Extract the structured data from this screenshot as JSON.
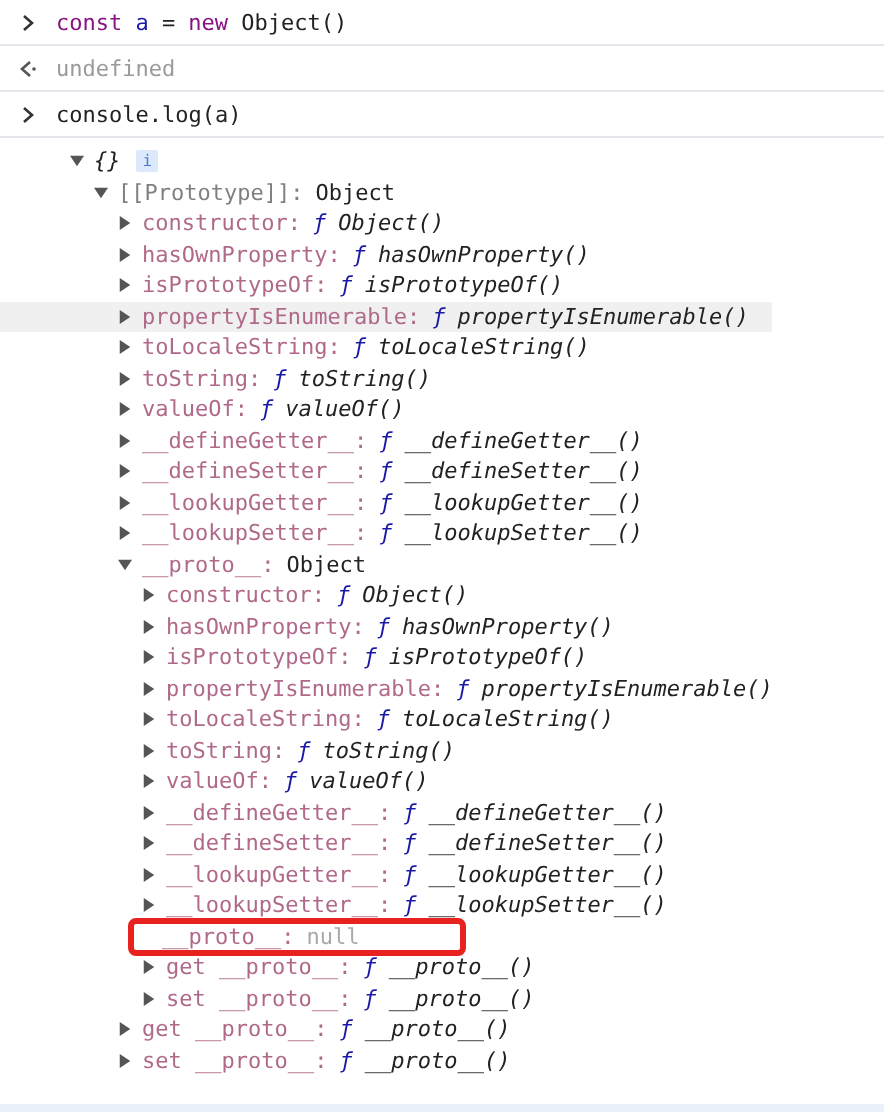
{
  "console": [
    {
      "kind": "input",
      "tokens": [
        {
          "text": "const",
          "kind": "keyword"
        },
        {
          "text": "a",
          "kind": "variable"
        },
        {
          "text": "=",
          "kind": "plain"
        },
        {
          "text": "new",
          "kind": "keyword"
        },
        {
          "text": "Object()",
          "kind": "plain"
        }
      ]
    },
    {
      "kind": "result",
      "text": "undefined"
    },
    {
      "kind": "input",
      "tokens": [
        {
          "text": "console.log(a)",
          "kind": "plain"
        }
      ]
    },
    {
      "kind": "log",
      "tree": {
        "label": "{}",
        "badge": "i",
        "expanded": true,
        "children": [
          {
            "key": "[[Prototype]]:",
            "kind": "object",
            "internal": true,
            "value": "Object",
            "expanded": true,
            "highlighted": false,
            "children": [
              {
                "key": "constructor:",
                "kind": "function",
                "marker": "ƒ",
                "value": "Object()",
                "expanded": false,
                "highlighted": false
              },
              {
                "key": "hasOwnProperty:",
                "kind": "function",
                "marker": "ƒ",
                "value": "hasOwnProperty()",
                "expanded": false,
                "highlighted": false
              },
              {
                "key": "isPrototypeOf:",
                "kind": "function",
                "marker": "ƒ",
                "value": "isPrototypeOf()",
                "expanded": false,
                "highlighted": false
              },
              {
                "key": "propertyIsEnumerable:",
                "kind": "function",
                "marker": "ƒ",
                "value": "propertyIsEnumerable()",
                "expanded": false,
                "highlighted": true
              },
              {
                "key": "toLocaleString:",
                "kind": "function",
                "marker": "ƒ",
                "value": "toLocaleString()",
                "expanded": false,
                "highlighted": false
              },
              {
                "key": "toString:",
                "kind": "function",
                "marker": "ƒ",
                "value": "toString()",
                "expanded": false,
                "highlighted": false
              },
              {
                "key": "valueOf:",
                "kind": "function",
                "marker": "ƒ",
                "value": "valueOf()",
                "expanded": false,
                "highlighted": false
              },
              {
                "key": "__defineGetter__:",
                "kind": "function",
                "marker": "ƒ",
                "value": "__defineGetter__()",
                "expanded": false,
                "highlighted": false
              },
              {
                "key": "__defineSetter__:",
                "kind": "function",
                "marker": "ƒ",
                "value": "__defineSetter__()",
                "expanded": false,
                "highlighted": false
              },
              {
                "key": "__lookupGetter__:",
                "kind": "function",
                "marker": "ƒ",
                "value": "__lookupGetter__()",
                "expanded": false,
                "highlighted": false
              },
              {
                "key": "__lookupSetter__:",
                "kind": "function",
                "marker": "ƒ",
                "value": "__lookupSetter__()",
                "expanded": false,
                "highlighted": false
              },
              {
                "key": "__proto__:",
                "kind": "object",
                "internal": false,
                "value": "Object",
                "expanded": true,
                "highlighted": false,
                "children": [
                  {
                    "key": "constructor:",
                    "kind": "function",
                    "marker": "ƒ",
                    "value": "Object()",
                    "expanded": false,
                    "highlighted": false
                  },
                  {
                    "key": "hasOwnProperty:",
                    "kind": "function",
                    "marker": "ƒ",
                    "value": "hasOwnProperty()",
                    "expanded": false,
                    "highlighted": false
                  },
                  {
                    "key": "isPrototypeOf:",
                    "kind": "function",
                    "marker": "ƒ",
                    "value": "isPrototypeOf()",
                    "expanded": false,
                    "highlighted": false
                  },
                  {
                    "key": "propertyIsEnumerable:",
                    "kind": "function",
                    "marker": "ƒ",
                    "value": "propertyIsEnumerable()",
                    "expanded": false,
                    "highlighted": false
                  },
                  {
                    "key": "toLocaleString:",
                    "kind": "function",
                    "marker": "ƒ",
                    "value": "toLocaleString()",
                    "expanded": false,
                    "highlighted": false
                  },
                  {
                    "key": "toString:",
                    "kind": "function",
                    "marker": "ƒ",
                    "value": "toString()",
                    "expanded": false,
                    "highlighted": false
                  },
                  {
                    "key": "valueOf:",
                    "kind": "function",
                    "marker": "ƒ",
                    "value": "valueOf()",
                    "expanded": false,
                    "highlighted": false
                  },
                  {
                    "key": "__defineGetter__:",
                    "kind": "function",
                    "marker": "ƒ",
                    "value": "__defineGetter__()",
                    "expanded": false,
                    "highlighted": false
                  },
                  {
                    "key": "__defineSetter__:",
                    "kind": "function",
                    "marker": "ƒ",
                    "value": "__defineSetter__()",
                    "expanded": false,
                    "highlighted": false
                  },
                  {
                    "key": "__lookupGetter__:",
                    "kind": "function",
                    "marker": "ƒ",
                    "value": "__lookupGetter__()",
                    "expanded": false,
                    "highlighted": false
                  },
                  {
                    "key": "__lookupSetter__:",
                    "kind": "function",
                    "marker": "ƒ",
                    "value": "__lookupSetter__()",
                    "expanded": false,
                    "highlighted": false
                  },
                  {
                    "key": "__proto__:",
                    "kind": "null",
                    "value": "null",
                    "highlighted": false,
                    "annotated": true
                  },
                  {
                    "key": "get __proto__:",
                    "kind": "function",
                    "marker": "ƒ",
                    "value": "__proto__()",
                    "expanded": false,
                    "highlighted": false
                  },
                  {
                    "key": "set __proto__:",
                    "kind": "function",
                    "marker": "ƒ",
                    "value": "__proto__()",
                    "expanded": false,
                    "highlighted": false
                  }
                ]
              },
              {
                "key": "get __proto__:",
                "kind": "function",
                "marker": "ƒ",
                "value": "__proto__()",
                "expanded": false,
                "highlighted": false
              },
              {
                "key": "set __proto__:",
                "kind": "function",
                "marker": "ƒ",
                "value": "__proto__()",
                "expanded": false,
                "highlighted": false
              }
            ]
          }
        ]
      }
    }
  ]
}
